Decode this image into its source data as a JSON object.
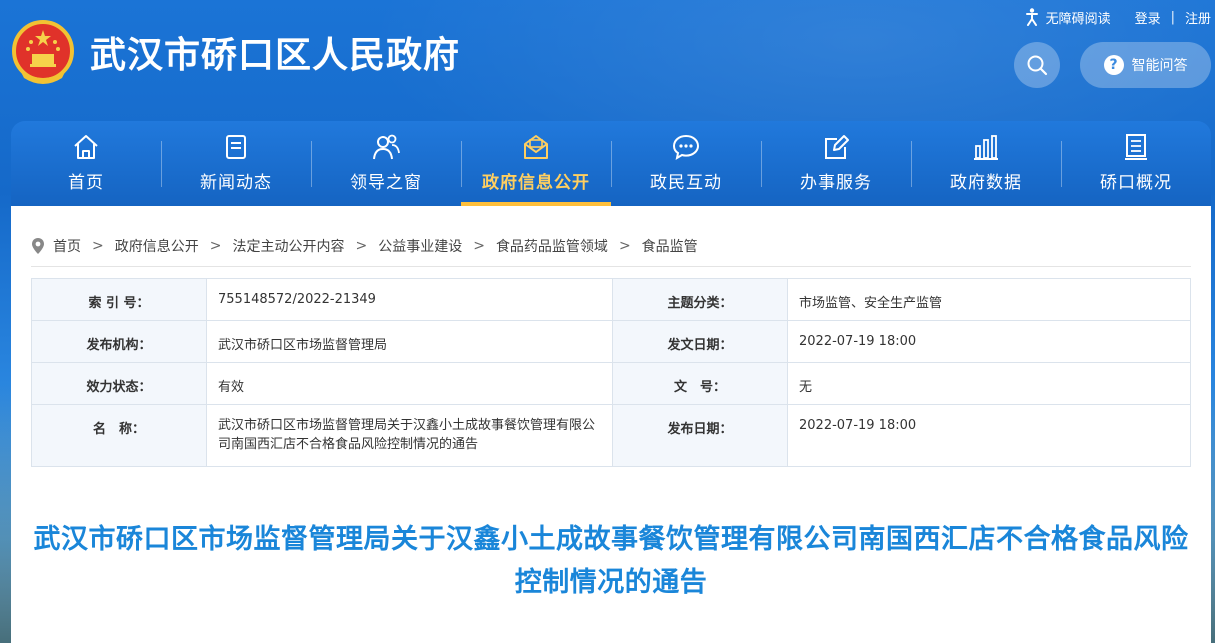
{
  "site": {
    "title": "武汉市硚口区人民政府"
  },
  "utility": {
    "accessibility": "无障碍阅读",
    "login": "登录",
    "separator": "|",
    "register": "注册"
  },
  "qa_button": {
    "label": "智能问答",
    "icon_char": "?"
  },
  "nav": {
    "items": [
      {
        "label": "首页",
        "icon": "home-icon"
      },
      {
        "label": "新闻动态",
        "icon": "news-icon"
      },
      {
        "label": "领导之窗",
        "icon": "leaders-icon"
      },
      {
        "label": "政府信息公开",
        "icon": "mail-icon",
        "active": true
      },
      {
        "label": "政民互动",
        "icon": "chat-icon"
      },
      {
        "label": "办事服务",
        "icon": "edit-icon"
      },
      {
        "label": "政府数据",
        "icon": "bar-chart-icon"
      },
      {
        "label": "硚口概况",
        "icon": "document-icon"
      }
    ]
  },
  "breadcrumb": {
    "items": [
      "首页",
      "政府信息公开",
      "法定主动公开内容",
      "公益事业建设",
      "食品药品监管领域",
      "食品监管"
    ],
    "separator": ">"
  },
  "meta": {
    "rows": [
      {
        "k1": "索 引 号：",
        "v1": "755148572/2022-21349",
        "k2": "主题分类：",
        "v2": "市场监管、安全生产监管"
      },
      {
        "k1": "发布机构：",
        "v1": "武汉市硚口区市场监督管理局",
        "k2": "发文日期：",
        "v2": "2022-07-19 18:00"
      },
      {
        "k1": "效力状态：",
        "v1": "有效",
        "k2": "文　号：",
        "v2": "无"
      },
      {
        "k1": "名　称：",
        "v1": "武汉市硚口区市场监督管理局关于汉鑫小土成故事餐饮管理有限公司南国西汇店不合格食品风险控制情况的通告",
        "k2": "发布日期：",
        "v2": "2022-07-19 18:00"
      }
    ]
  },
  "document": {
    "title": "武汉市硚口区市场监督管理局关于汉鑫小土成故事餐饮管理有限公司南国西汇店不合格食品风险控制情况的通告"
  },
  "colors": {
    "header_blue": "#1b74d6",
    "nav_active": "#ffbf3a",
    "title_blue": "#1a86d9",
    "table_key_bg": "#f3f7fc"
  }
}
